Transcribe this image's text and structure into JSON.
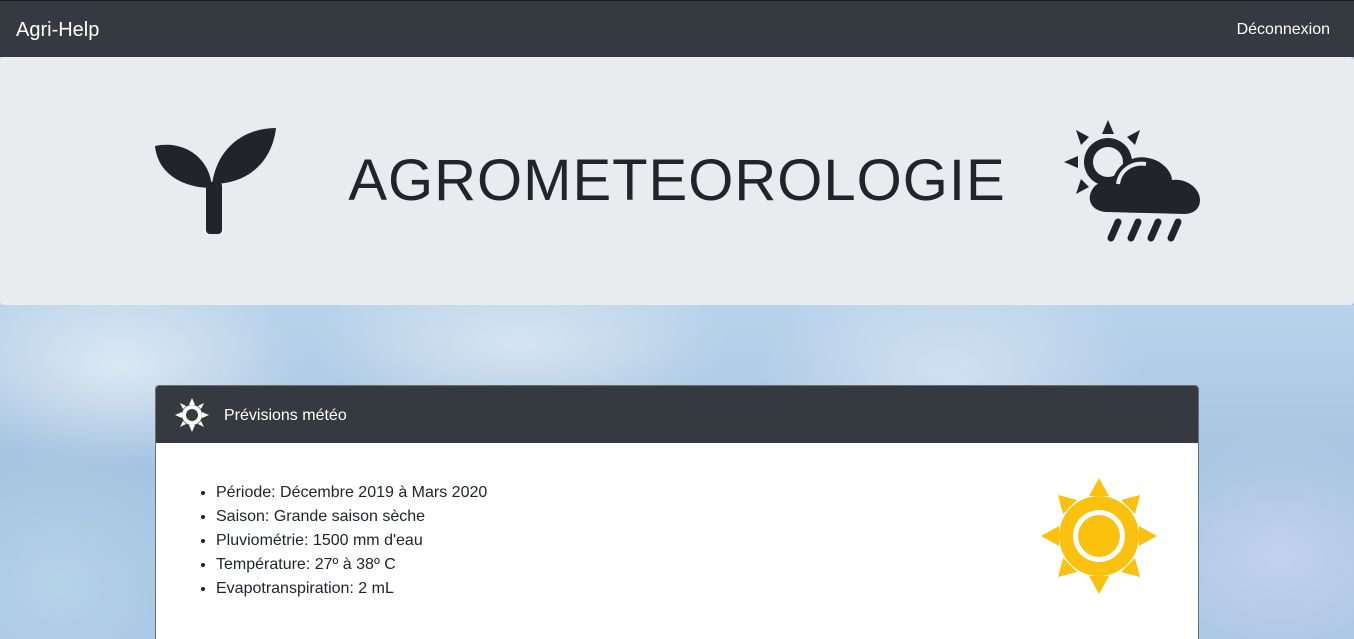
{
  "navbar": {
    "brand": "Agri-Help",
    "logout_label": "Déconnexion"
  },
  "header": {
    "title": "AGROMETEOROLOGIE",
    "left_icon": "seedling-icon",
    "right_icon": "cloud-sun-rain-icon"
  },
  "forecast_card": {
    "title": "Prévisions météo",
    "header_icon": "sun-outline-icon",
    "side_icon": "sun-icon",
    "items": [
      "Période: Décembre 2019 à Mars 2020",
      "Saison: Grande saison sèche",
      "Pluviométrie: 1500 mm d'eau",
      "Température: 27º à 38º C",
      "Evapotranspiration: 2 mL"
    ]
  },
  "colors": {
    "navbar_bg": "#343a40",
    "jumbotron_bg": "#e8ecef",
    "sun_yellow": "#fbc10f",
    "text_dark": "#212529"
  }
}
